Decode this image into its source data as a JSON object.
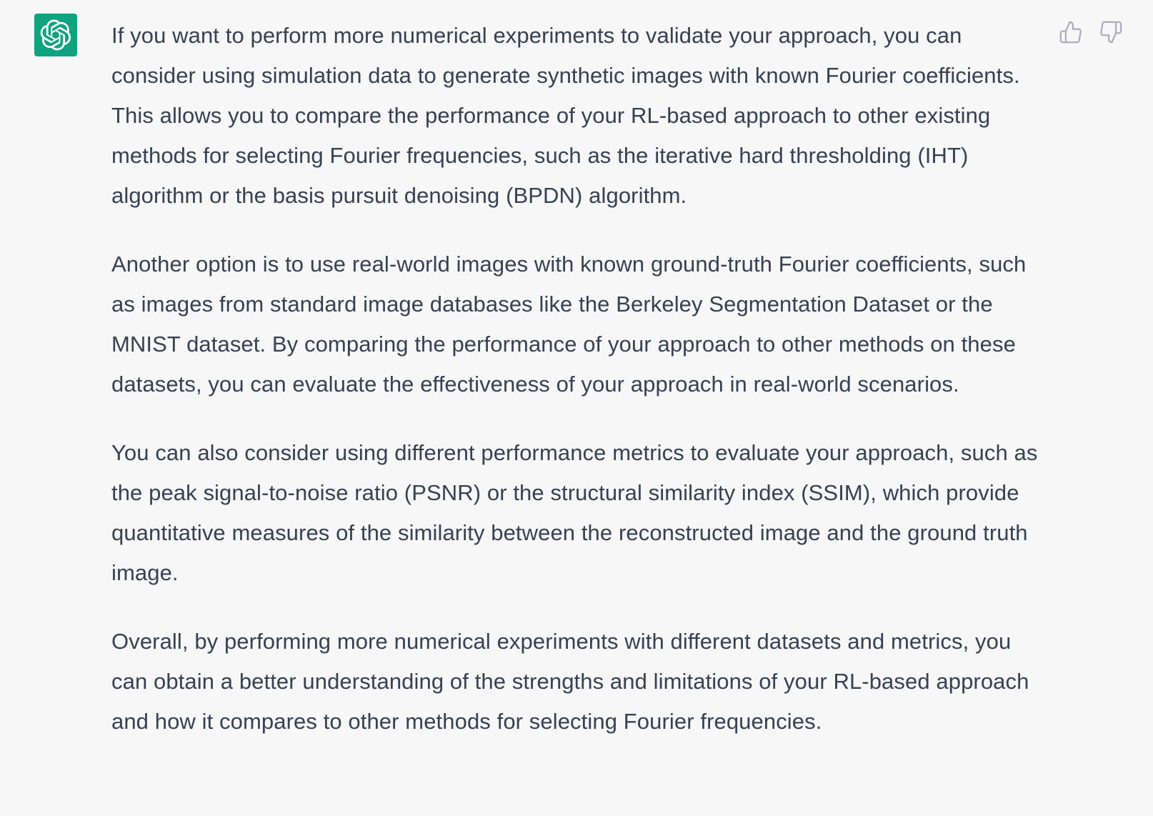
{
  "message": {
    "author_icon": "openai-logo-icon",
    "brand_color": "#10a37f",
    "paragraphs": [
      "If you want to perform more numerical experiments to validate your approach, you can consider using simulation data to generate synthetic images with known Fourier coefficients. This allows you to compare the performance of your RL-based approach to other existing methods for selecting Fourier frequencies, such as the iterative hard thresholding (IHT) algorithm or the basis pursuit denoising (BPDN) algorithm.",
      "Another option is to use real-world images with known ground-truth Fourier coefficients, such as images from standard image databases like the Berkeley Segmentation Dataset or the MNIST dataset. By comparing the performance of your approach to other methods on these datasets, you can evaluate the effectiveness of your approach in real-world scenarios.",
      "You can also consider using different performance metrics to evaluate your approach, such as the peak signal-to-noise ratio (PSNR) or the structural similarity index (SSIM), which provide quantitative measures of the similarity between the reconstructed image and the ground truth image.",
      "Overall, by performing more numerical experiments with different datasets and metrics, you can obtain a better understanding of the strengths and limitations of your RL-based approach and how it compares to other methods for selecting Fourier frequencies."
    ]
  },
  "feedback": {
    "thumbs_up_icon": "thumbs-up-icon",
    "thumbs_down_icon": "thumbs-down-icon"
  }
}
